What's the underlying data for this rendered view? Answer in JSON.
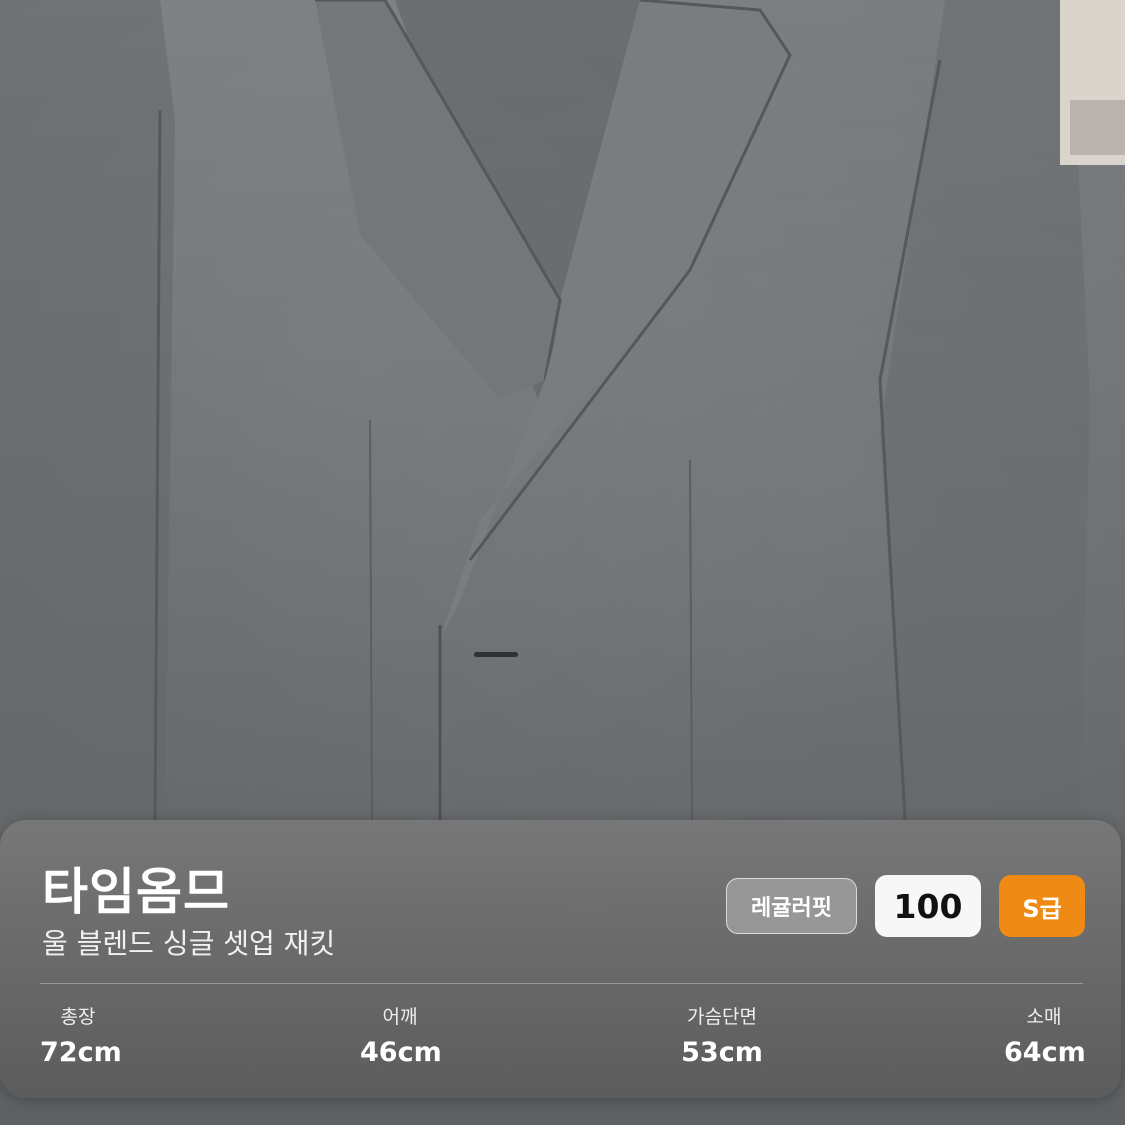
{
  "product_card": {
    "brand": "타임옴므",
    "name": "울 블렌드 싱글 셋업 재킷",
    "fit": "레귤러핏",
    "size": "100",
    "grade": "S급"
  },
  "measurements": [
    {
      "label": "총장",
      "value": "72cm"
    },
    {
      "label": "어깨",
      "value": "46cm"
    },
    {
      "label": "가슴단면",
      "value": "53cm"
    },
    {
      "label": "소매",
      "value": "64cm"
    }
  ],
  "colors": {
    "grade_accent": "#ef8a14",
    "fabric": "#6f7274"
  }
}
